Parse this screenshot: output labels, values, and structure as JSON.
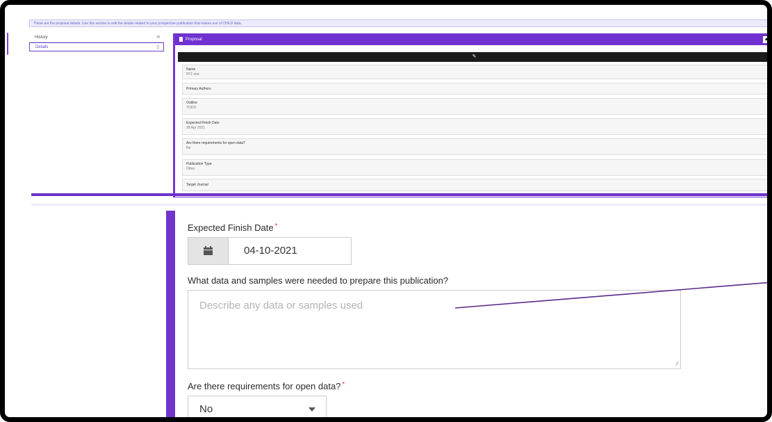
{
  "top_screenshot": {
    "info_text": "These are the proposal details. Use this section to edit the details related to your prospective publication that makes use of CHILD data.",
    "sidebar": {
      "items": [
        {
          "label": "History",
          "icon": "history-icon",
          "glyph": "⟲"
        },
        {
          "label": "Details",
          "icon": "clipboard-icon",
          "glyph": "▯"
        }
      ]
    },
    "panel": {
      "title": "Proposal",
      "edit_glyph": "✎",
      "toggle_glyph": "▲",
      "fields": [
        {
          "label": "Name",
          "value": "PF1 test"
        },
        {
          "label": "Primary Authors",
          "value": ""
        },
        {
          "label": "Outline",
          "value": "TODO"
        },
        {
          "label": "Expected Finish Date",
          "value": "28 Apr 2021"
        },
        {
          "label": "Are there requirements for open data?",
          "value": "No"
        },
        {
          "label": "Publication Type",
          "value": "Other"
        },
        {
          "label": "Target Journal",
          "value": ""
        }
      ]
    }
  },
  "form": {
    "expected_finish_date": {
      "label": "Expected Finish Date",
      "required_mark": "*",
      "value": "04-10-2021"
    },
    "data_samples": {
      "label": "What data and samples were needed to prepare this publication?",
      "placeholder": "Describe any data or samples used"
    },
    "open_data": {
      "label": "Are there requirements for open data?",
      "required_mark": "*",
      "value": "No"
    }
  },
  "colors": {
    "accent": "#6f31cf",
    "required": "#e03131",
    "callout": "#5a2a8a"
  }
}
